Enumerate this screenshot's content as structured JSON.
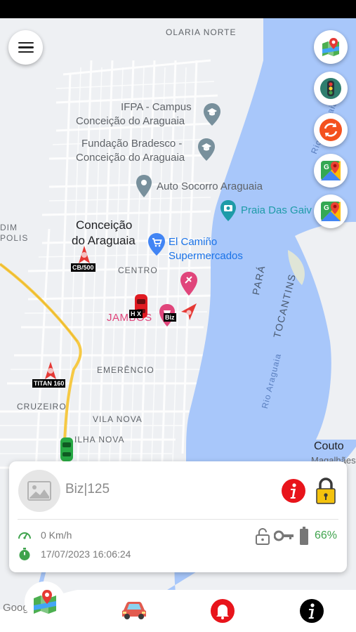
{
  "map": {
    "labels": {
      "olaria_norte": "OLARIA NORTE",
      "ifpa_line1": "IFPA - Campus",
      "ifpa_line2": "Conceição do Araguaia",
      "bradesco_line1": "Fundação Bradesco -",
      "bradesco_line2": "Conceição do Araguaia",
      "auto_socorro": "Auto Socorro Araguaia",
      "praia": "Praia Das Gaiv",
      "dim": "DIM",
      "polis": "POLIS",
      "city_line1": "Conceição",
      "city_line2": "do Araguaia",
      "elcamino_line1": "El Camiño",
      "elcamino_line2": "Supermercados",
      "centro": "CENTRO",
      "jambos": "JAMBOS",
      "emerencio": "EMERÊNCIO",
      "cruzeiro": "CRUZEIRO",
      "vila_nova": "VILA NOVA",
      "ilha_nova": "ILHA NOVA",
      "para": "PARÁ",
      "tocantins": "TOCANTINS",
      "rio_araguaia_1": "Rio Araguaia",
      "rio_araguaia_2": "Rio Araguaia",
      "couto": "Couto",
      "couto_sub": "Magalhães",
      "google": "Google"
    },
    "vehicle_tags": {
      "cb500": "CB/500",
      "hx": "H X",
      "biz": "Biz",
      "titan": "TITAN 160"
    }
  },
  "card": {
    "vehicle_name": "Biz|125",
    "speed": "0 Km/h",
    "datetime": "17/07/2023 16:06:24",
    "battery": "66%"
  },
  "colors": {
    "accent_green": "#3fa34d",
    "alert_red": "#e8141b",
    "lock_yellow": "#f4c20d",
    "water": "#a8c7fa"
  },
  "icons": {
    "menu": "hamburger-icon",
    "layers": "map-layers-icon",
    "traffic": "traffic-light-icon",
    "refresh": "refresh-icon",
    "gmaps": "google-maps-icon",
    "gmaps2": "google-maps-route-icon"
  }
}
